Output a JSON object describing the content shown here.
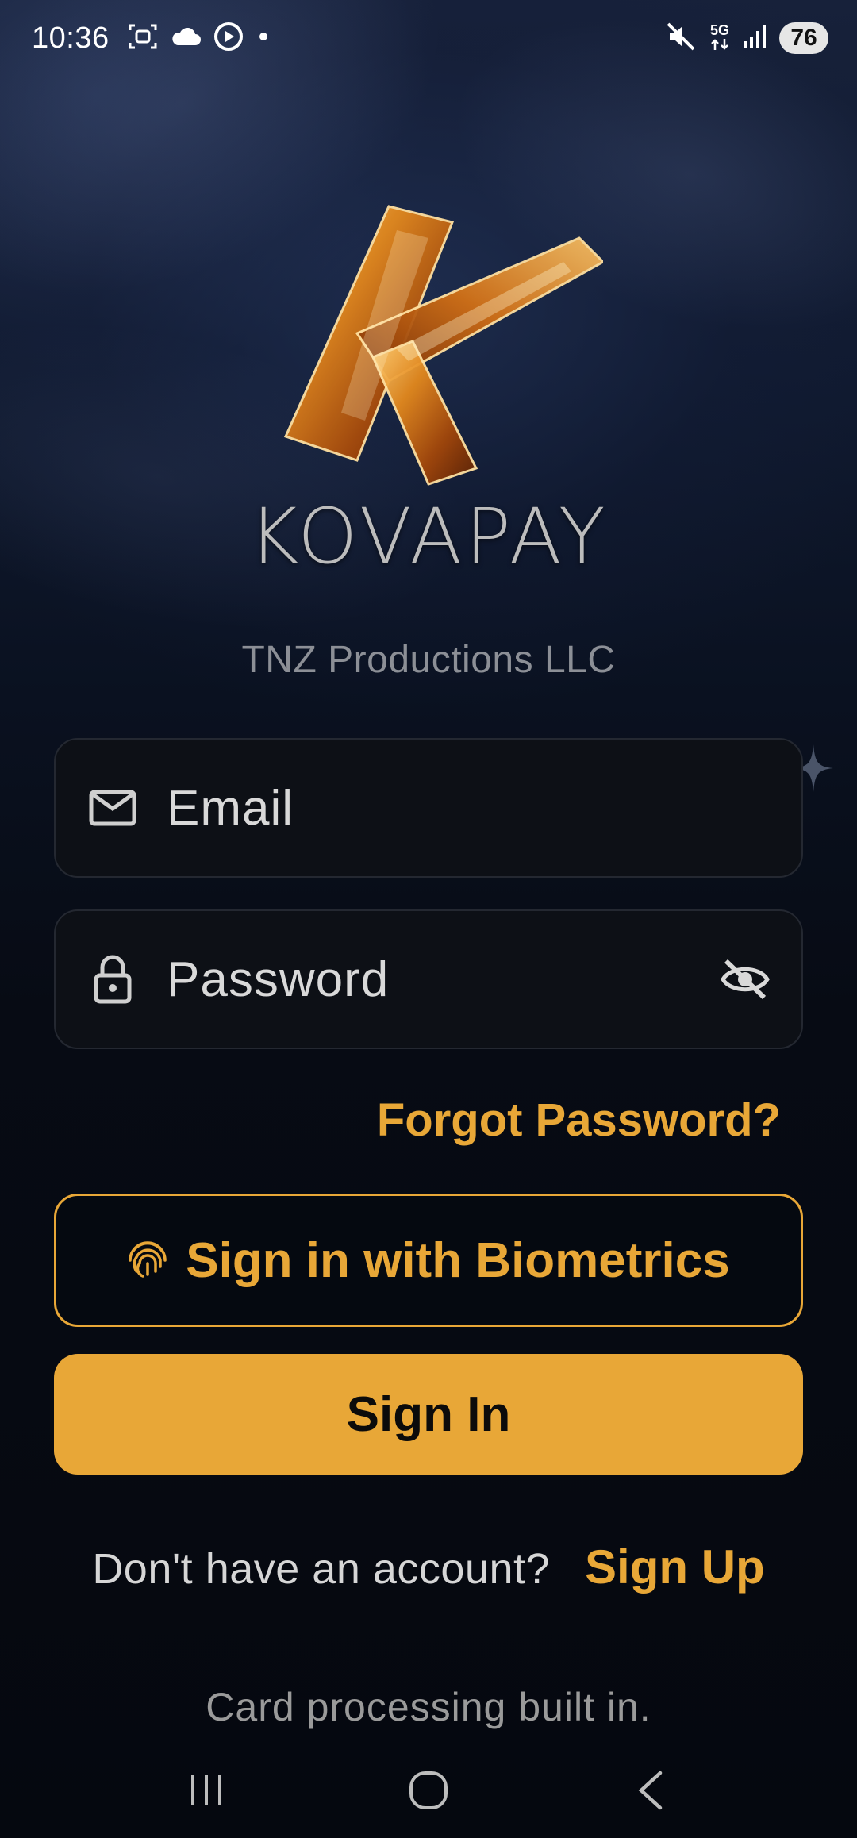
{
  "status_bar": {
    "time": "10:36",
    "network": "5G",
    "battery": "76",
    "icons_left": [
      "screenshot-icon",
      "cloud-icon",
      "play-circle-icon",
      "dot-icon"
    ],
    "icons_right": [
      "mute-icon",
      "5g-icon",
      "signal-icon",
      "battery-icon"
    ]
  },
  "brand": {
    "logo_icon": "kovapay-k-logo",
    "name": "KOVAPAY",
    "company": "TNZ Productions LLC"
  },
  "login_form": {
    "email_placeholder": "Email",
    "password_placeholder": "Password",
    "forgot_password": "Forgot Password?",
    "biometrics_button": "Sign in with Biometrics",
    "signin_button": "Sign In"
  },
  "signup": {
    "prompt": "Don't have an account?",
    "link": "Sign Up"
  },
  "footer": {
    "note": "Card processing built in."
  },
  "colors": {
    "accent": "#e8a737",
    "background": "#05080f",
    "field_background": "#0d1016"
  }
}
